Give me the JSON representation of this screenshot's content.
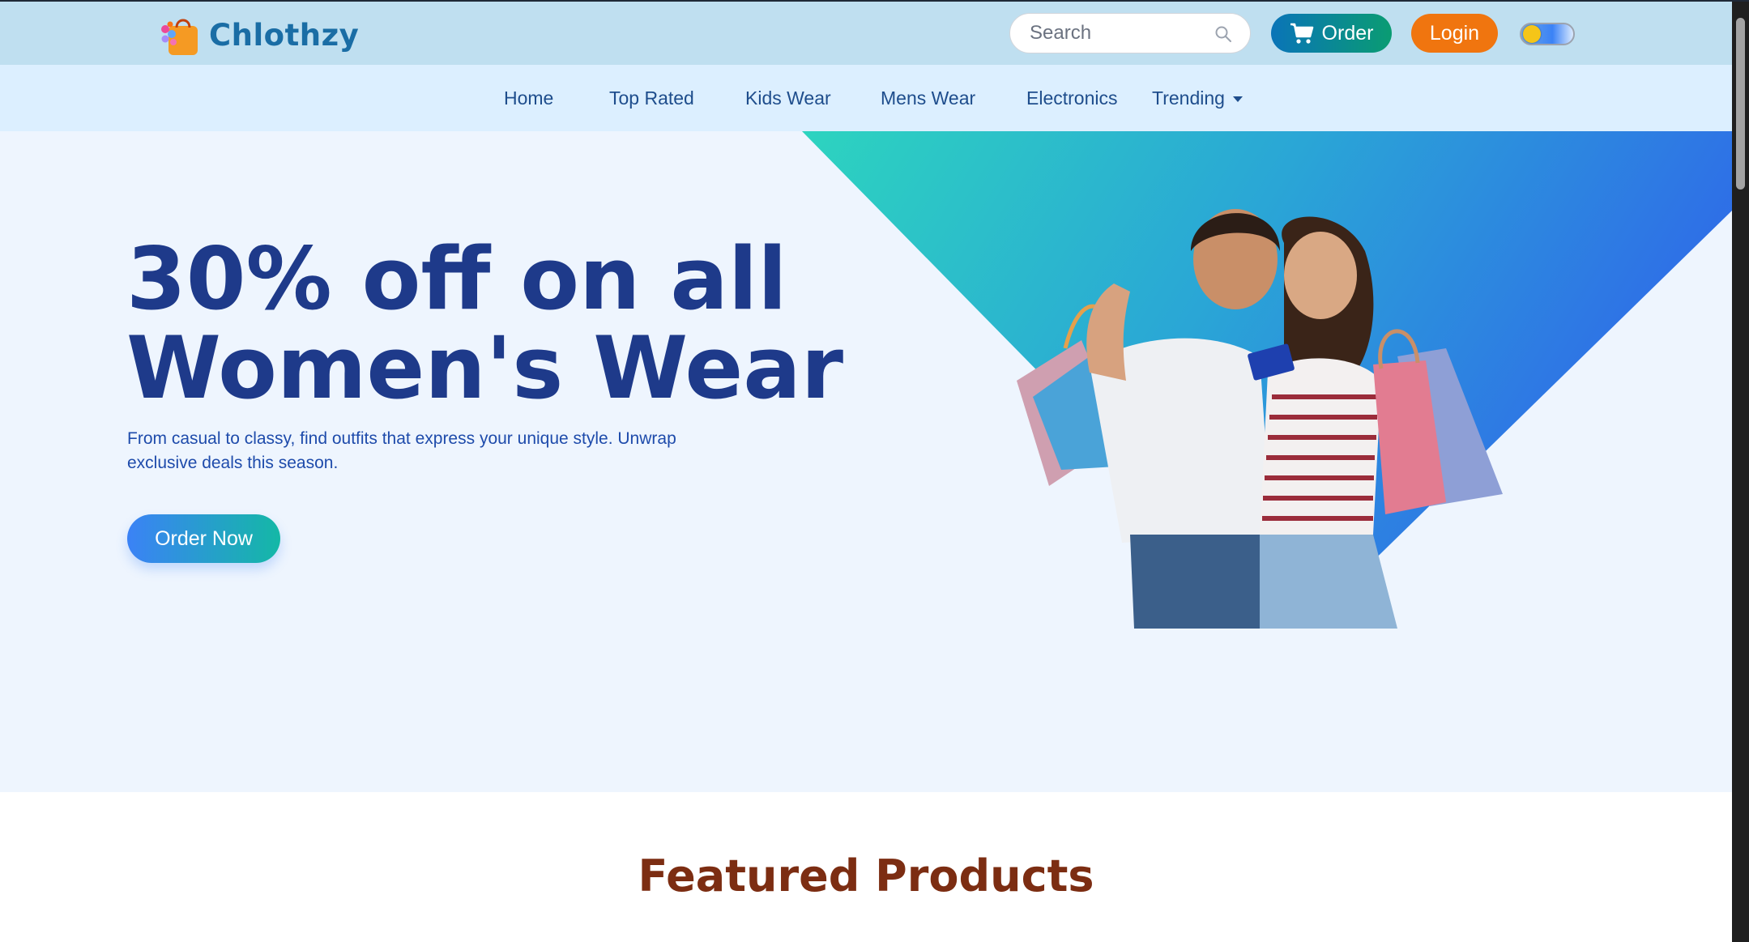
{
  "brand": {
    "name": "Chlothzy",
    "logo_icon": "shopping-bag-icon"
  },
  "header": {
    "search_placeholder": "Search",
    "search_icon": "search-icon",
    "order_label": "Order",
    "order_icon": "cart-icon",
    "login_label": "Login",
    "theme_toggle": "dark-mode-toggle"
  },
  "nav": {
    "items": [
      {
        "label": "Home"
      },
      {
        "label": "Top Rated"
      },
      {
        "label": "Kids Wear"
      },
      {
        "label": "Mens Wear"
      },
      {
        "label": "Electronics"
      },
      {
        "label": "Trending"
      }
    ]
  },
  "hero": {
    "title_line1": "30% off on all",
    "title_line2": "Women's Wear",
    "subtitle": "From casual to classy, find outfits that express your unique style. Unwrap exclusive deals this season.",
    "cta_label": "Order Now"
  },
  "featured": {
    "title": "Featured Products"
  },
  "colors": {
    "topbar_bg": "#bfdff0",
    "nav_bg": "#dcefff",
    "hero_bg": "#eef5fe",
    "title_blue": "#1e3a8a",
    "login_orange": "#f0750f",
    "featured_brown": "#7c2d12"
  }
}
